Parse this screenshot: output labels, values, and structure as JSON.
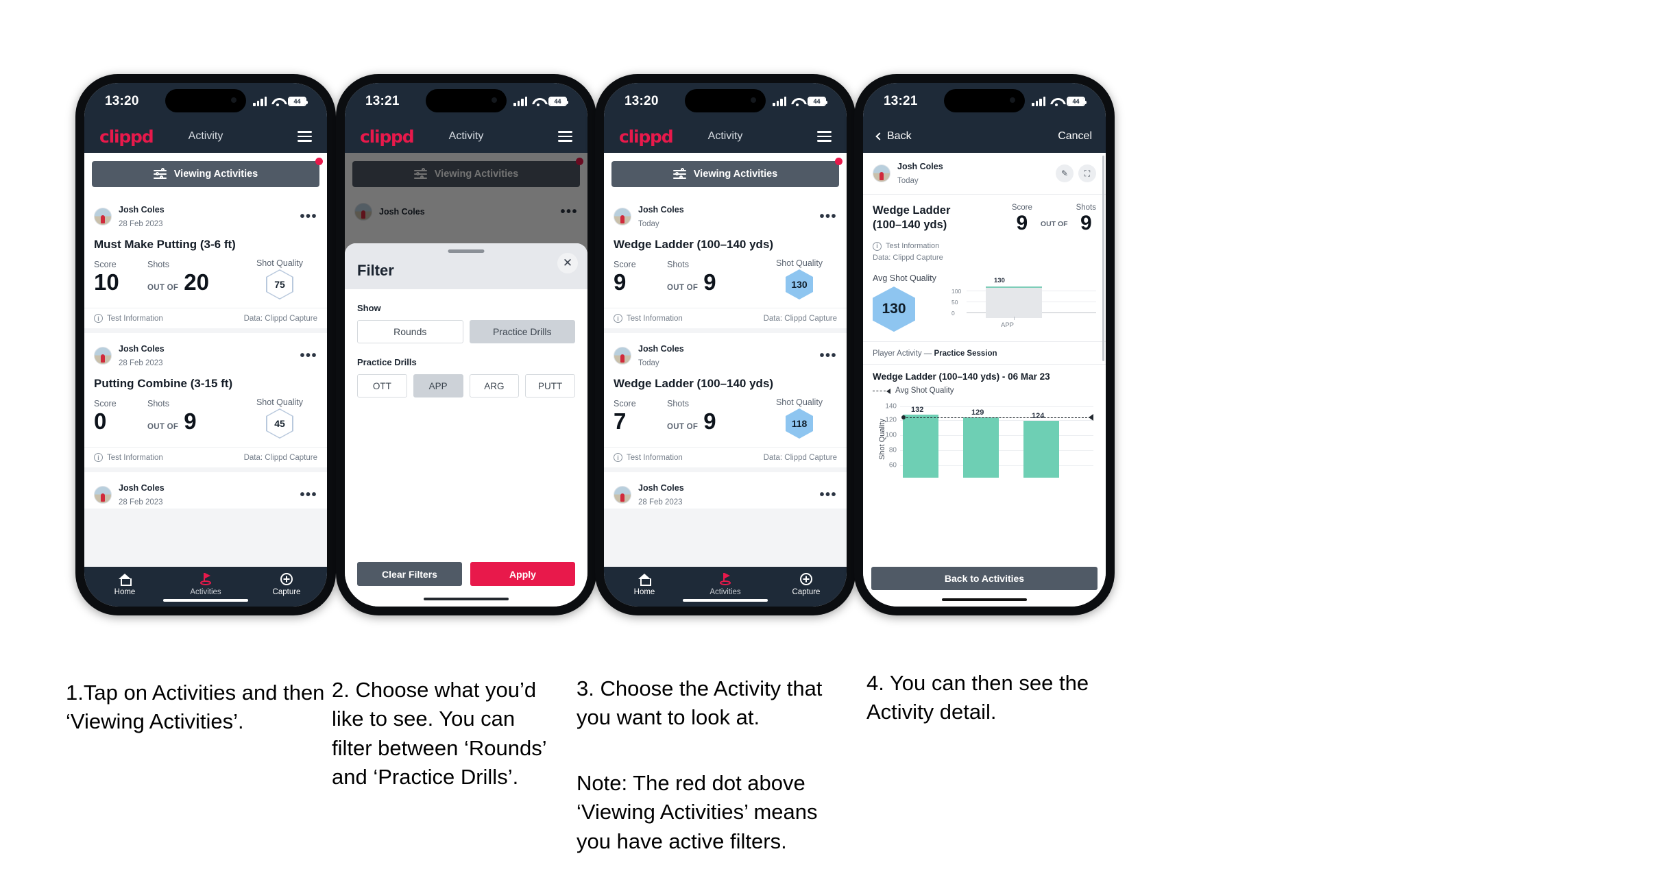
{
  "phones": [
    {
      "id": "phone-1",
      "status": {
        "time": "13:20",
        "battery": "44"
      },
      "appbar": {
        "logo": "clippd",
        "title": "Activity"
      },
      "viewbar": {
        "label": "Viewing Activities",
        "red_dot": true
      },
      "cards": [
        {
          "user": "Josh Coles",
          "date": "28 Feb 2023",
          "title": "Must Make Putting (3-6 ft)",
          "score_label": "Score",
          "shots_label": "Shots",
          "quality_label": "Shot Quality",
          "score": "10",
          "out_of": "OUT OF",
          "shots": "20",
          "quality": "75",
          "quality_style": "outline",
          "foot_left": "Test Information",
          "foot_right": "Data: Clippd Capture"
        },
        {
          "user": "Josh Coles",
          "date": "28 Feb 2023",
          "title": "Putting Combine (3-15 ft)",
          "score_label": "Score",
          "shots_label": "Shots",
          "quality_label": "Shot Quality",
          "score": "0",
          "out_of": "OUT OF",
          "shots": "9",
          "quality": "45",
          "quality_style": "outline",
          "foot_left": "Test Information",
          "foot_right": "Data: Clippd Capture"
        },
        {
          "user": "Josh Coles",
          "date": "28 Feb 2023"
        }
      ],
      "tabs": [
        {
          "label": "Home",
          "icon": "home-icon",
          "active": false
        },
        {
          "label": "Activities",
          "icon": "golf-flag-icon",
          "active": true
        },
        {
          "label": "Capture",
          "icon": "plus-circle-icon",
          "active": false
        }
      ]
    },
    {
      "id": "phone-2",
      "status": {
        "time": "13:21",
        "battery": "44"
      },
      "appbar": {
        "logo": "clippd",
        "title": "Activity"
      },
      "viewbar": {
        "label": "Viewing Activities",
        "red_dot": true
      },
      "behind_card": {
        "user": "Josh Coles"
      },
      "modal": {
        "title": "Filter",
        "close": "✕",
        "show_label": "Show",
        "show_options": [
          {
            "label": "Rounds",
            "selected": false
          },
          {
            "label": "Practice Drills",
            "selected": true
          }
        ],
        "drills_label": "Practice Drills",
        "drills": [
          {
            "label": "OTT",
            "selected": false
          },
          {
            "label": "APP",
            "selected": true
          },
          {
            "label": "ARG",
            "selected": false
          },
          {
            "label": "PUTT",
            "selected": false
          }
        ],
        "clear_label": "Clear Filters",
        "apply_label": "Apply"
      }
    },
    {
      "id": "phone-3",
      "status": {
        "time": "13:20",
        "battery": "44"
      },
      "appbar": {
        "logo": "clippd",
        "title": "Activity"
      },
      "viewbar": {
        "label": "Viewing Activities",
        "red_dot": true
      },
      "cards": [
        {
          "user": "Josh Coles",
          "date": "Today",
          "title": "Wedge Ladder (100–140 yds)",
          "score_label": "Score",
          "shots_label": "Shots",
          "quality_label": "Shot Quality",
          "score": "9",
          "out_of": "OUT OF",
          "shots": "9",
          "quality": "130",
          "quality_style": "filled",
          "foot_left": "Test Information",
          "foot_right": "Data: Clippd Capture"
        },
        {
          "user": "Josh Coles",
          "date": "Today",
          "title": "Wedge Ladder (100–140 yds)",
          "score_label": "Score",
          "shots_label": "Shots",
          "quality_label": "Shot Quality",
          "score": "7",
          "out_of": "OUT OF",
          "shots": "9",
          "quality": "118",
          "quality_style": "filled",
          "foot_left": "Test Information",
          "foot_right": "Data: Clippd Capture"
        },
        {
          "user": "Josh Coles",
          "date": "28 Feb 2023"
        }
      ],
      "tabs": [
        {
          "label": "Home",
          "icon": "home-icon",
          "active": false
        },
        {
          "label": "Activities",
          "icon": "golf-flag-icon",
          "active": true
        },
        {
          "label": "Capture",
          "icon": "plus-circle-icon",
          "active": false
        }
      ]
    },
    {
      "id": "phone-4",
      "status": {
        "time": "13:21",
        "battery": "44"
      },
      "navbar": {
        "back": "Back",
        "cancel": "Cancel"
      },
      "detail": {
        "user": "Josh Coles",
        "date": "Today",
        "edit_icon": "pencil-icon",
        "expand_icon": "fullscreen-icon",
        "title": "Wedge Ladder (100–140 yds)",
        "score_label": "Score",
        "shots_label": "Shots",
        "score": "9",
        "out_of": "OUT OF",
        "shots": "9",
        "info_line": "Test Information",
        "data_line": "Data: Clippd Capture",
        "avg_quality_label": "Avg Shot Quality",
        "avg_quality_value": "130",
        "section_label_prefix": "Player Activity — ",
        "section_label_bold": "Practice Session",
        "chart_title": "Wedge Ladder (100–140 yds) - 06 Mar 23",
        "legend": "Avg Shot Quality",
        "back_button": "Back to Activities"
      }
    }
  ],
  "chart_data": [
    {
      "type": "bar",
      "title": "Avg Shot Quality by category",
      "categories": [
        "APP"
      ],
      "values": [
        130
      ],
      "ylabel": "",
      "yticks": [
        0,
        50,
        100
      ],
      "ylim": [
        0,
        140
      ],
      "grid": true,
      "legend": "none"
    },
    {
      "type": "bar",
      "title": "Wedge Ladder (100–140 yds) - 06 Mar 23",
      "categories": [
        "1",
        "2",
        "3"
      ],
      "values": [
        132,
        129,
        124
      ],
      "data_labels": [
        "132",
        "129",
        "124"
      ],
      "ylabel": "Shot Quality",
      "yticks": [
        60,
        80,
        100,
        120,
        140
      ],
      "ylim": [
        50,
        145
      ],
      "grid": true,
      "legend": "Avg Shot Quality",
      "reference_line": {
        "label": "Avg Shot Quality",
        "style": "dashed",
        "value": 130
      },
      "bar_color": "#6ecfb4"
    }
  ],
  "captions": [
    "1.Tap on Activities and then ‘Viewing Activities’.",
    "2. Choose what you’d like to see. You can filter between ‘Rounds’ and ‘Practice Drills’.",
    "3. Choose the Activity that you want to look at.",
    "Note: The red dot above ‘Viewing Activities’ means you have active filters.",
    "4. You can then see the Activity detail."
  ],
  "colors": {
    "navy": "#1e2a38",
    "red": "#e8194b",
    "slate": "#505a66",
    "teal": "#6ecfb4",
    "hex_blue": "#8ec5f0"
  }
}
